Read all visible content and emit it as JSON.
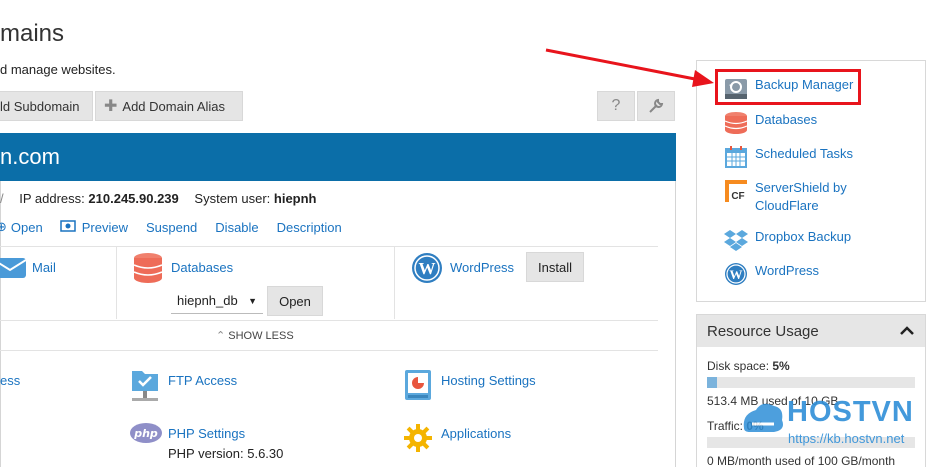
{
  "page": {
    "title": "mains",
    "subtitle": "d manage websites."
  },
  "toolbar": {
    "add_subdomain": "ld Subdomain",
    "add_domain_alias": "Add Domain Alias",
    "help_icon": "question-icon",
    "settings_icon": "wrench-icon"
  },
  "domain": {
    "name": "n.com",
    "ip_label": "IP address:",
    "ip_value": "210.245.90.239",
    "user_label": "System user:",
    "user_value": "hiepnh",
    "actions": [
      "Open",
      "Preview",
      "Suspend",
      "Disable",
      "Description"
    ]
  },
  "quick": {
    "mail": "Mail",
    "databases": "Databases",
    "db_selected": "hiepnh_db",
    "db_open": "Open",
    "wordpress": "WordPress",
    "install": "Install",
    "show_less": "SHOW LESS"
  },
  "tools": {
    "access_partial": "ess",
    "ftp": "FTP Access",
    "hosting": "Hosting Settings",
    "php": "PHP Settings",
    "php_version": "PHP version: 5.6.30",
    "applications": "Applications"
  },
  "sidebar": {
    "items": [
      {
        "label": "Backup Manager",
        "icon": "backup-icon"
      },
      {
        "label": "Databases",
        "icon": "database-icon"
      },
      {
        "label": "Scheduled Tasks",
        "icon": "calendar-icon"
      },
      {
        "label": "ServerShield by CloudFlare",
        "icon": "cloudflare-icon"
      },
      {
        "label": "Dropbox Backup",
        "icon": "dropbox-icon"
      },
      {
        "label": "WordPress",
        "icon": "wordpress-icon"
      }
    ]
  },
  "resource": {
    "title": "Resource Usage",
    "disk_label": "Disk space:",
    "disk_value": "5%",
    "disk_fill": 0.05,
    "disk_detail": "513.4 MB used of 10 GB",
    "traffic_label": "Traffic:",
    "traffic_value": "0%",
    "traffic_fill": 0,
    "traffic_detail": "0 MB/month used of 100 GB/month"
  },
  "watermark": {
    "brand": "HOSTVN",
    "url": "https://kb.hostvn.net"
  },
  "colors": {
    "accent": "#0b6ea8",
    "link": "#1a73c0",
    "highlight": "#e8141c"
  }
}
